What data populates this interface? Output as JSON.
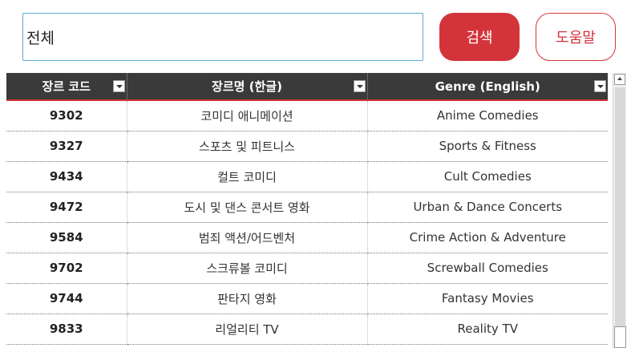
{
  "search": {
    "value": "전체",
    "search_button": "검색",
    "help_button": "도움말"
  },
  "table": {
    "headers": [
      "장르 코드",
      "장르명 (한글)",
      "Genre (English)"
    ],
    "rows": [
      {
        "code": "9302",
        "korean": "코미디 애니메이션",
        "english": "Anime Comedies"
      },
      {
        "code": "9327",
        "korean": "스포츠 및 피트니스",
        "english": "Sports & Fitness"
      },
      {
        "code": "9434",
        "korean": "컬트 코미디",
        "english": "Cult Comedies"
      },
      {
        "code": "9472",
        "korean": "도시 및 댄스 콘서트 영화",
        "english": "Urban & Dance Concerts"
      },
      {
        "code": "9584",
        "korean": "범죄 액션/어드벤처",
        "english": "Crime Action & Adventure"
      },
      {
        "code": "9702",
        "korean": "스크류볼 코미디",
        "english": "Screwball Comedies"
      },
      {
        "code": "9744",
        "korean": "판타지 영화",
        "english": "Fantasy Movies"
      },
      {
        "code": "9833",
        "korean": "리얼리티 TV",
        "english": "Reality TV"
      }
    ]
  },
  "colors": {
    "accent": "#d3343a",
    "header_bg": "#3a3a3a",
    "input_border": "#5aa9d8"
  }
}
